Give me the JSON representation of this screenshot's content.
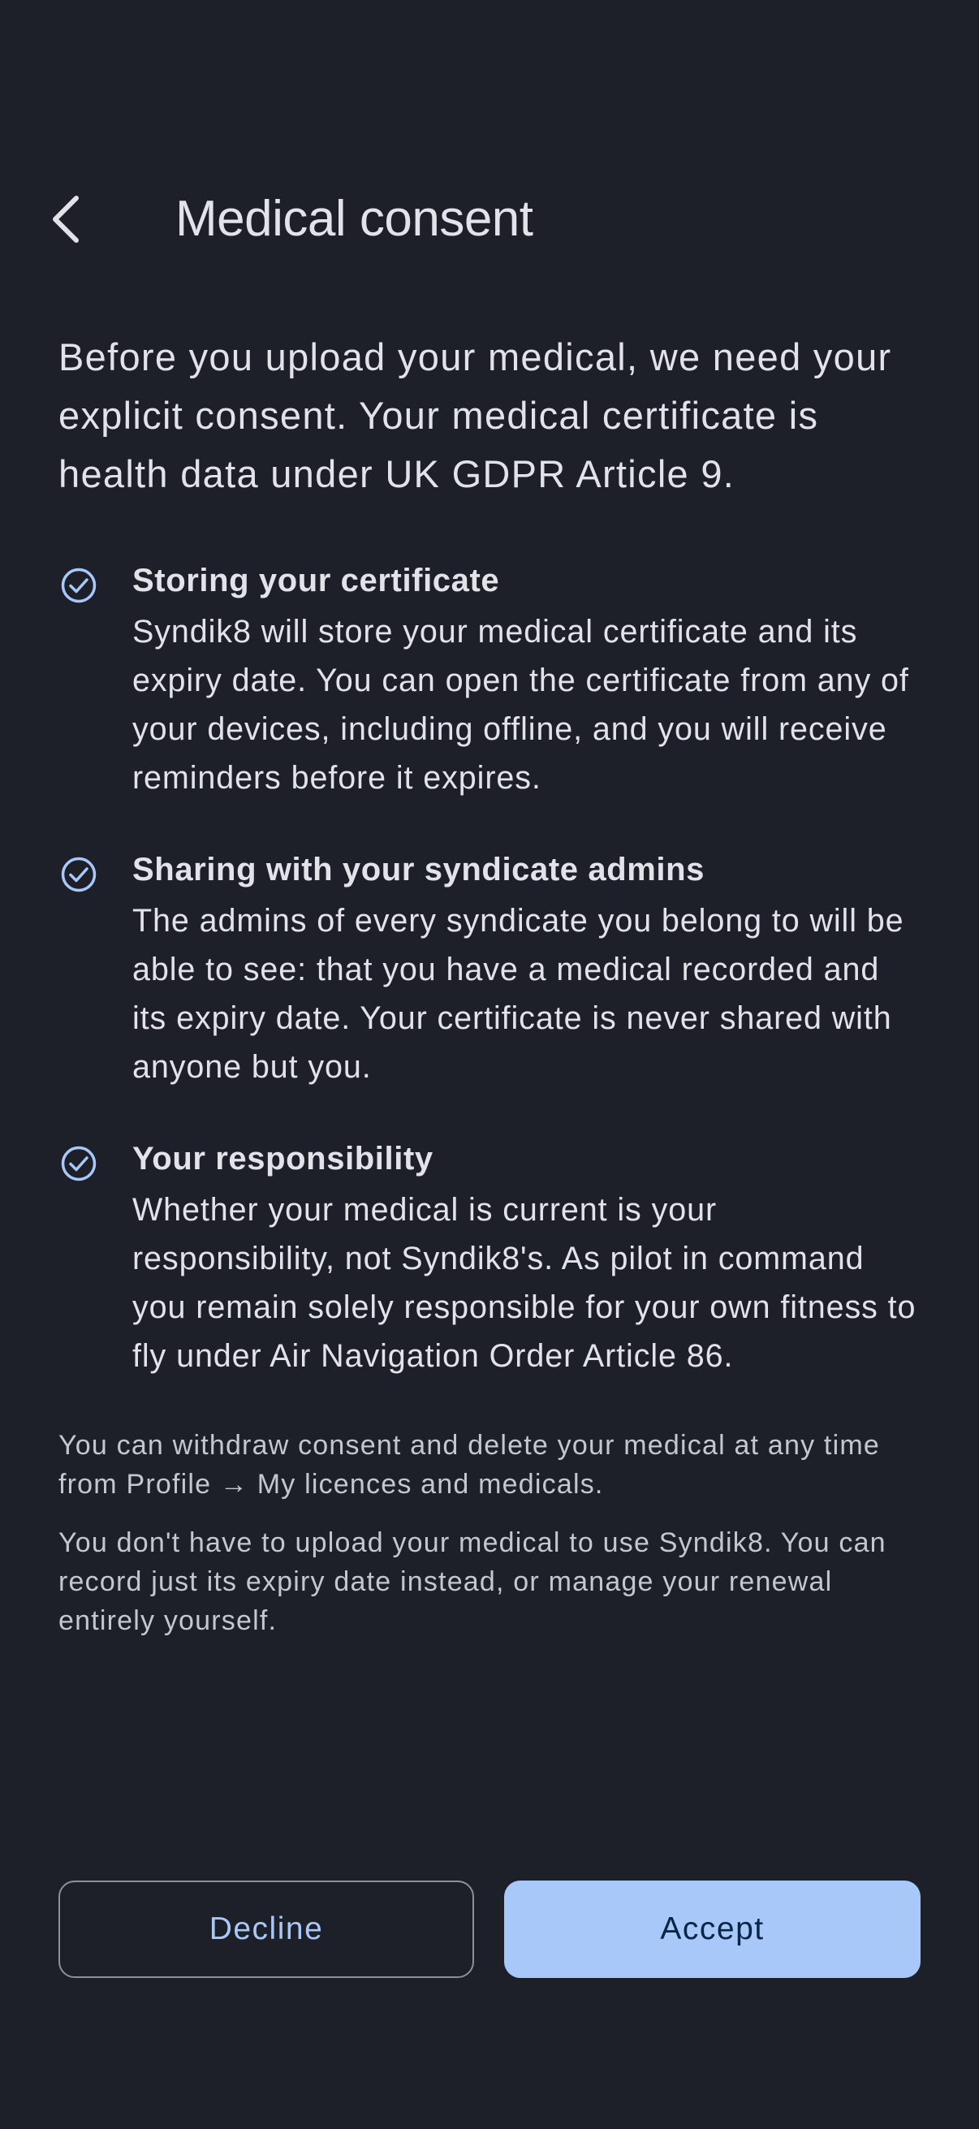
{
  "header": {
    "back_icon": "chevron-left-icon",
    "title": "Medical consent"
  },
  "intro": "Before you upload your medical, we need your explicit consent. Your medical certificate is health data under UK GDPR Article 9.",
  "points": [
    {
      "icon": "check-circle-icon",
      "title": "Storing your certificate",
      "body": "Syndik8 will store your medical certificate and its expiry date. You can open the certificate from any of your devices, including offline, and you will receive reminders before it expires."
    },
    {
      "icon": "check-circle-icon",
      "title": "Sharing with your syndicate admins",
      "body": "The admins of every syndicate you belong to will be able to see: that you have a medical recorded and its expiry date. Your certificate is never shared with anyone but you."
    },
    {
      "icon": "check-circle-icon",
      "title": "Your responsibility",
      "body": "Whether your medical is current is your responsibility, not Syndik8's. As pilot in command you remain solely responsible for your own fitness to fly under Air Navigation Order Article 86."
    }
  ],
  "notes": [
    "You can withdraw consent and delete your medical at any time from Profile → My licences and medicals.",
    "You don't have to upload your medical to use Syndik8. You can record just its expiry date instead, or manage your renewal entirely yourself."
  ],
  "actions": {
    "decline_label": "Decline",
    "accept_label": "Accept"
  },
  "colors": {
    "background": "#1d1f29",
    "accent": "#a8c8fa",
    "text": "#e2e2e9"
  }
}
